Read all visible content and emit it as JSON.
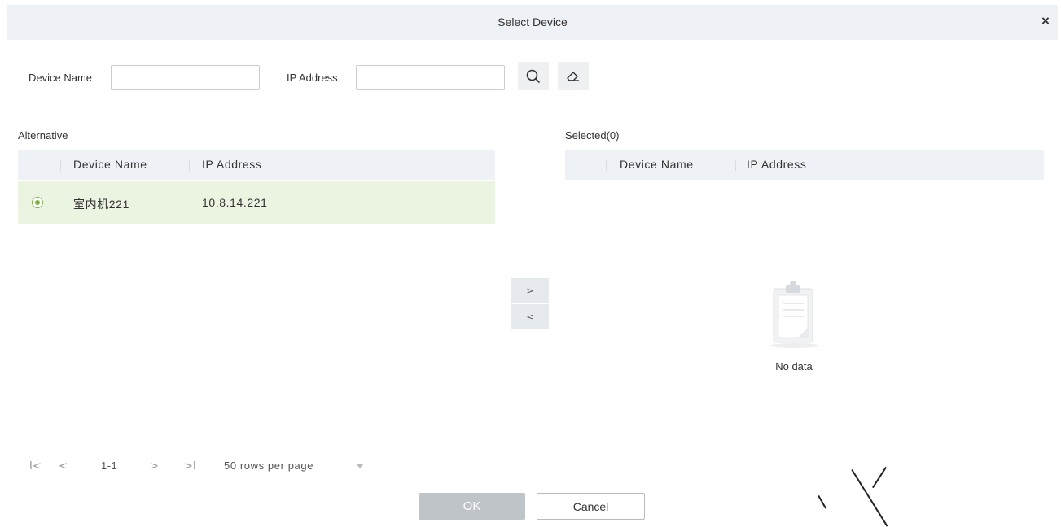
{
  "dialog": {
    "title": "Select Device",
    "close_label": "×"
  },
  "search": {
    "device_name_label": "Device Name",
    "device_name_value": "",
    "ip_address_label": "IP Address",
    "ip_address_value": "",
    "search_icon": "search-icon",
    "clear_icon": "eraser-icon"
  },
  "alternative": {
    "caption": "Alternative",
    "columns": [
      "Device Name",
      "IP Address"
    ],
    "rows": [
      {
        "device_name": "室内机221",
        "ip_address": "10.8.14.221",
        "selected": true
      }
    ]
  },
  "selected": {
    "caption": "Selected(0)",
    "columns": [
      "Device Name",
      "IP Address"
    ],
    "empty_text": "No data",
    "empty_icon": "clipboard-icon"
  },
  "transfer": {
    "add_label": ">",
    "remove_label": "<"
  },
  "pager": {
    "first": "I<",
    "prev": "<",
    "range": "1-1",
    "next": ">",
    "last": ">I",
    "rows_per_page": "50 rows per page"
  },
  "footer": {
    "ok_label": "OK",
    "cancel_label": "Cancel"
  },
  "colors": {
    "header_bg": "#eef1f5",
    "selected_row_bg": "#eaf4e0",
    "accent_green": "#7cb442",
    "ok_disabled_bg": "#bfc4c8"
  }
}
